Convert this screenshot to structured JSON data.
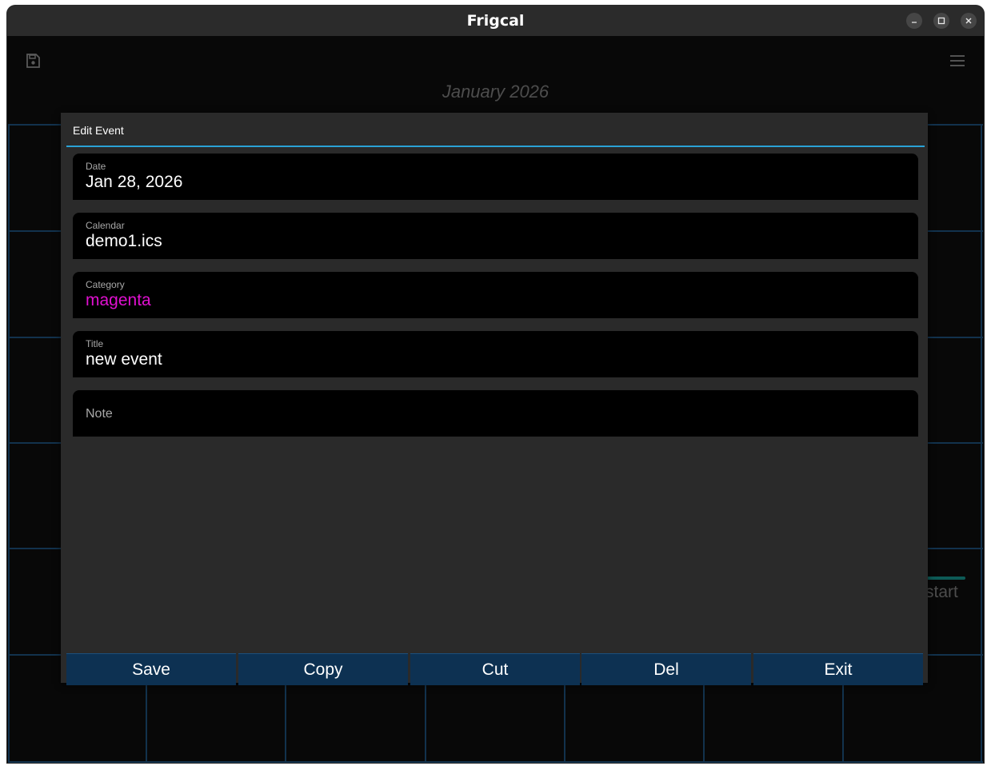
{
  "window": {
    "title": "Frigcal"
  },
  "calendar_view": {
    "month_title": "January 2026",
    "partial_event_text": "start"
  },
  "dialog": {
    "title": "Edit Event",
    "fields": [
      {
        "label": "Date",
        "value": "Jan 28, 2026"
      },
      {
        "label": "Calendar",
        "value": "demo1.ics"
      },
      {
        "label": "Category",
        "value": "magenta"
      },
      {
        "label": "Title",
        "value": "new event"
      }
    ],
    "note": {
      "placeholder": "Note",
      "value": ""
    },
    "buttons": [
      "Save",
      "Copy",
      "Cut",
      "Del",
      "Exit"
    ]
  },
  "colors": {
    "accent": "#2aa2d6",
    "button_bg": "#0d3152",
    "category_text": "#e010d0",
    "grid_line": "#12324d"
  },
  "icons": {
    "toolbar_left": "save-icon",
    "toolbar_right": "menu-icon",
    "window_controls": [
      "minimize-icon",
      "maximize-icon",
      "close-icon"
    ]
  }
}
